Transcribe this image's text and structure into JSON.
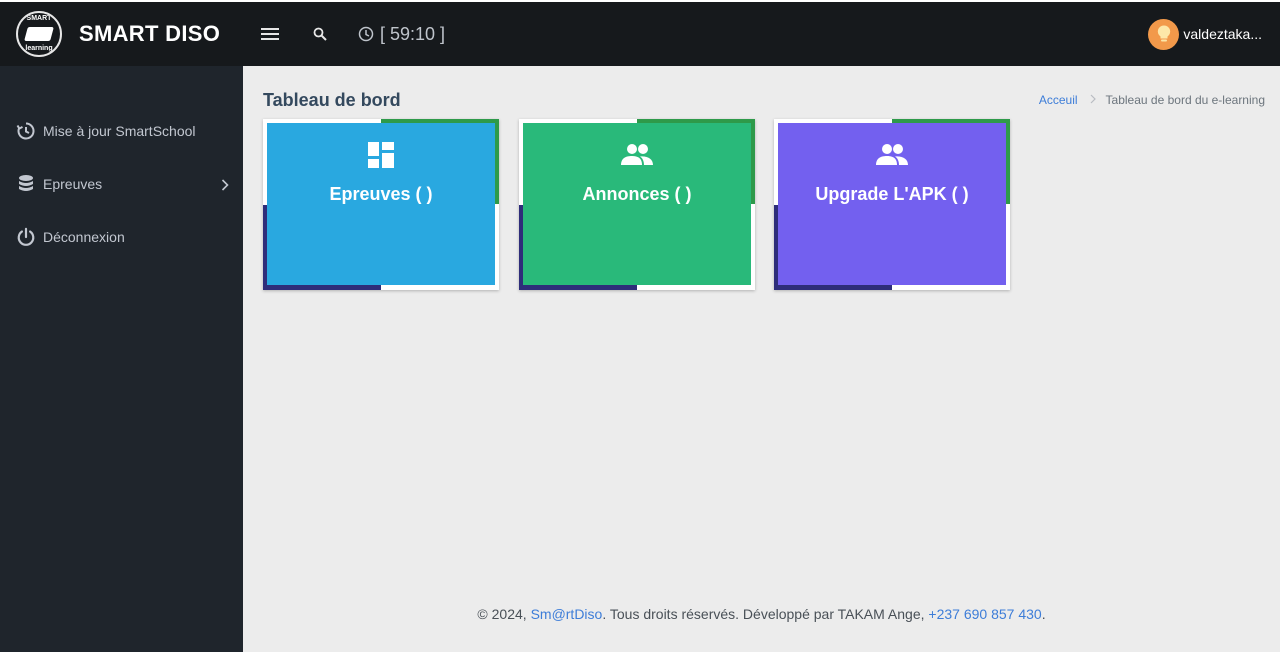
{
  "app": {
    "brand_title": "SMART DISO",
    "logo_text_top": "SMART",
    "logo_text_bottom": "learning"
  },
  "sidebar": {
    "items": [
      {
        "label": "Mise à jour SmartSchool",
        "icon": "refresh-clock-icon"
      },
      {
        "label": "Epreuves",
        "icon": "database-icon",
        "has_submenu": true
      },
      {
        "label": "Déconnexion",
        "icon": "power-icon"
      }
    ]
  },
  "topbar": {
    "timer": "[ 59:10 ]",
    "username": "valdeztaka..."
  },
  "main": {
    "page_title": "Tableau de bord",
    "breadcrumb": {
      "home": "Acceuil",
      "current": "Tableau de bord du e-learning"
    },
    "cards": [
      {
        "label": "Epreuves ( )",
        "icon": "dashboard-icon",
        "color": "#29a8e0"
      },
      {
        "label": "Annonces ( )",
        "icon": "users-icon",
        "color": "#29b97a"
      },
      {
        "label": "Upgrade L'APK ( )",
        "icon": "users-icon",
        "color": "#7360ef"
      }
    ]
  },
  "footer": {
    "prefix": "© 2024, ",
    "brand_link": "Sm@rtDiso",
    "middle": ". Tous droits réservés. Développé par TAKAM Ange, ",
    "phone_link": "+237 690 857 430",
    "suffix": "."
  },
  "colors": {
    "sidebar_bg": "#1f252c",
    "topbar_bg": "#16191c",
    "accent_green": "#2e9a4a",
    "accent_navy": "#2e2d7a",
    "link": "#3d7dd8"
  }
}
